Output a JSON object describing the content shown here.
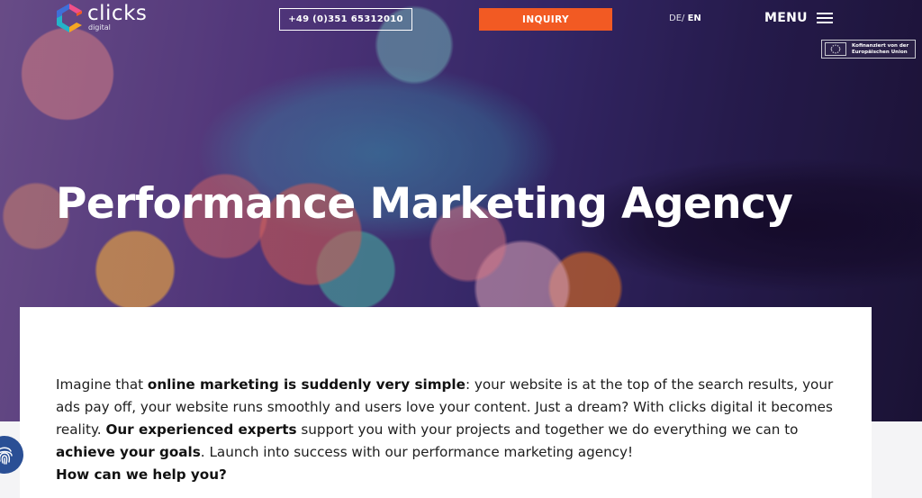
{
  "header": {
    "logo": {
      "word": "clicks",
      "sub": "digital"
    },
    "phone": "+49 (0)351 65312010",
    "inquiry": "INQUIRY",
    "lang": {
      "de": "DE",
      "sep": "/",
      "en": "EN"
    },
    "menu": "MENU",
    "eu_badge": {
      "line1": "Kofinanziert von der",
      "line2": "Europäischen Union"
    }
  },
  "hero": {
    "title": "Performance Marketing Agency"
  },
  "intro": {
    "p1_a": "Imagine that ",
    "p1_b": "online marketing is suddenly very simple",
    "p1_c": ": your website is at the top of the search results, your ads pay off, your website runs smoothly and users love your content. Just a dream? With clicks digital it becomes reality. ",
    "p1_d": "Our experienced experts",
    "p1_e": " support you with your projects and together we do everything we can to ",
    "p1_f": "achieve your goals",
    "p1_g": ". Launch into success with our performance marketing agency!",
    "question": "How can we help you?"
  },
  "colors": {
    "accent": "#f25a23",
    "fingerprint_bg": "#2a4f95"
  },
  "icons": {
    "menu": "hamburger-icon",
    "fingerprint": "fingerprint-icon",
    "eu": "eu-flag-icon"
  }
}
